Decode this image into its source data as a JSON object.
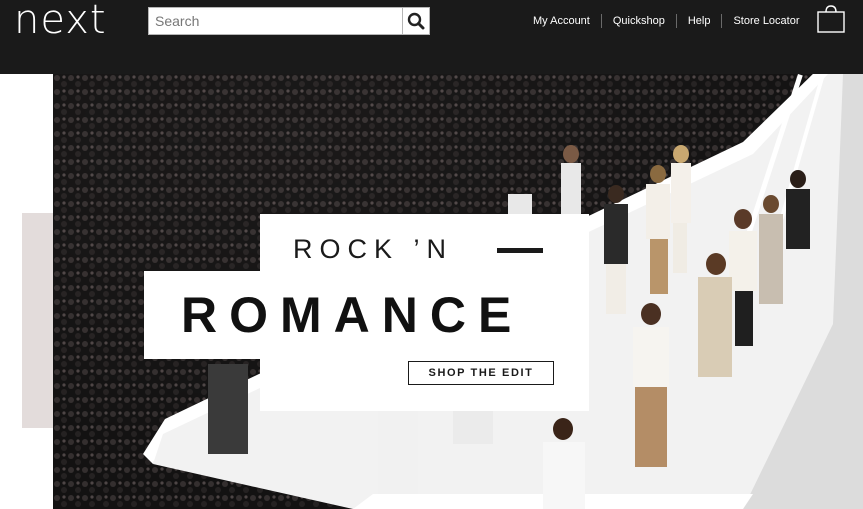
{
  "header": {
    "logo": "next",
    "search": {
      "placeholder": "Search",
      "value": ""
    },
    "nav": [
      "My Account",
      "Quickshop",
      "Help",
      "Store Locator"
    ],
    "icons": [
      "search-icon",
      "shopping-bag-icon"
    ]
  },
  "hero": {
    "headline_line1": "ROCK ’N",
    "headline_line2": "ROMANCE",
    "cta_label": "SHOP THE EDIT"
  },
  "colors": {
    "header_bg": "#1a1a1a",
    "side_panel": "#e3dcdb",
    "text_dark": "#1a1a1a",
    "white": "#ffffff"
  }
}
